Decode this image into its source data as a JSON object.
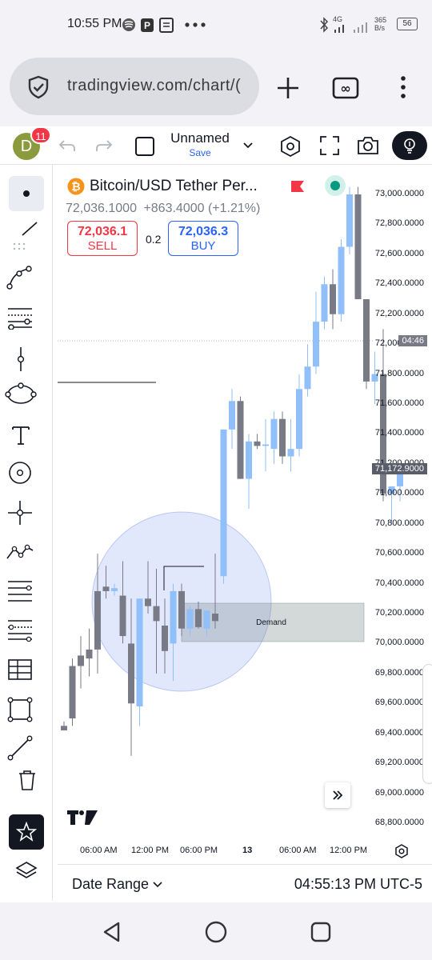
{
  "status_bar": {
    "time": "10:55 PM",
    "network_label": "4G",
    "speed_value": "365",
    "speed_unit": "B/s",
    "battery": "56"
  },
  "browser": {
    "url": "tradingview.com/chart/("
  },
  "toolbar": {
    "avatar_letter": "D",
    "notification_count": "11",
    "layout_name": "Unnamed",
    "save_label": "Save"
  },
  "symbol": {
    "title": "Bitcoin/USD Tether Per...",
    "last_price": "72,036.1000",
    "change": "+863.4000 (+1.21%)",
    "sell_price": "72,036.1",
    "sell_label": "SELL",
    "spread": "0.2",
    "buy_price": "72,036.3",
    "buy_label": "BUY"
  },
  "price_axis": {
    "ticks": [
      "73,000.0000",
      "72,800.0000",
      "72,600.0000",
      "72,400.0000",
      "72,200.0000",
      "72,000.0000",
      "71,800.0000",
      "71,600.0000",
      "71,400.0000",
      "71,200.0000",
      "71,000.0000",
      "70,800.0000",
      "70,600.0000",
      "70,400.0000",
      "70,200.0000",
      "70,000.0000",
      "69,800.0000",
      "69,600.0000",
      "69,400.0000",
      "69,200.0000",
      "69,000.0000",
      "68,800.0000"
    ],
    "countdown_tag": "04:46",
    "current_price_tag": "71,172.9000"
  },
  "time_axis": {
    "ticks": [
      "06:00 AM",
      "12:00 PM",
      "06:00 PM",
      "13",
      "06:00 AM",
      "12:00 PM"
    ]
  },
  "annotations": {
    "demand_label": "Demand"
  },
  "bottom_bar": {
    "date_range_label": "Date Range",
    "clock": "04:55:13 PM UTC-5"
  },
  "colors": {
    "up_candle": "#90bff9",
    "down_candle": "#787b86",
    "accent": "#2962ff",
    "sell": "#f23645",
    "notification": "#f23645"
  },
  "chart_data": {
    "type": "candlestick",
    "ylim": [
      68800,
      73000
    ],
    "candles": [
      {
        "o": 69450,
        "h": 69480,
        "l": 69420,
        "c": 69420
      },
      {
        "o": 69850,
        "h": 69900,
        "l": 69450,
        "c": 69500
      },
      {
        "o": 69920,
        "h": 70050,
        "l": 69700,
        "c": 69850
      },
      {
        "o": 69960,
        "h": 70100,
        "l": 69780,
        "c": 69900
      },
      {
        "o": 70350,
        "h": 70600,
        "l": 69800,
        "c": 69960
      },
      {
        "o": 70380,
        "h": 70520,
        "l": 70300,
        "c": 70350
      },
      {
        "o": 70350,
        "h": 70400,
        "l": 70320,
        "c": 70370
      },
      {
        "o": 70320,
        "h": 70550,
        "l": 70000,
        "c": 70050
      },
      {
        "o": 70000,
        "h": 70300,
        "l": 69250,
        "c": 69600
      },
      {
        "o": 69580,
        "h": 70100,
        "l": 69450,
        "c": 70300
      },
      {
        "o": 70300,
        "h": 70550,
        "l": 70200,
        "c": 70250
      },
      {
        "o": 70250,
        "h": 70500,
        "l": 69800,
        "c": 70150
      },
      {
        "o": 70120,
        "h": 70300,
        "l": 69800,
        "c": 69950
      },
      {
        "o": 70000,
        "h": 70400,
        "l": 69750,
        "c": 70350
      },
      {
        "o": 70350,
        "h": 70400,
        "l": 70050,
        "c": 70100
      },
      {
        "o": 70100,
        "h": 70250,
        "l": 70050,
        "c": 70230
      },
      {
        "o": 70230,
        "h": 70280,
        "l": 70100,
        "c": 70110
      },
      {
        "o": 70100,
        "h": 70200,
        "l": 70050,
        "c": 70220
      },
      {
        "o": 70200,
        "h": 70600,
        "l": 70100,
        "c": 70150
      },
      {
        "o": 70450,
        "h": 71400,
        "l": 70400,
        "c": 71430
      },
      {
        "o": 71430,
        "h": 71700,
        "l": 71300,
        "c": 71620
      },
      {
        "o": 71620,
        "h": 71650,
        "l": 71100,
        "c": 71100
      },
      {
        "o": 71100,
        "h": 71400,
        "l": 70900,
        "c": 71350
      },
      {
        "o": 71350,
        "h": 71400,
        "l": 71300,
        "c": 71320
      },
      {
        "o": 71320,
        "h": 71500,
        "l": 71150,
        "c": 71330
      },
      {
        "o": 71300,
        "h": 71550,
        "l": 71200,
        "c": 71500
      },
      {
        "o": 71500,
        "h": 71550,
        "l": 71200,
        "c": 71250
      },
      {
        "o": 71250,
        "h": 71500,
        "l": 71150,
        "c": 71300
      },
      {
        "o": 71300,
        "h": 71800,
        "l": 71250,
        "c": 71700
      },
      {
        "o": 71700,
        "h": 72000,
        "l": 71650,
        "c": 71850
      },
      {
        "o": 71850,
        "h": 72350,
        "l": 71800,
        "c": 72150
      },
      {
        "o": 72150,
        "h": 72450,
        "l": 72100,
        "c": 72400
      },
      {
        "o": 72400,
        "h": 72500,
        "l": 72100,
        "c": 72200
      },
      {
        "o": 72200,
        "h": 72700,
        "l": 72150,
        "c": 72650
      },
      {
        "o": 72650,
        "h": 73050,
        "l": 72600,
        "c": 73000
      },
      {
        "o": 73000,
        "h": 73050,
        "l": 72300,
        "c": 72300
      },
      {
        "o": 72300,
        "h": 72200,
        "l": 71700,
        "c": 71750
      },
      {
        "o": 71750,
        "h": 71950,
        "l": 71600,
        "c": 71800
      },
      {
        "o": 71800,
        "h": 72100,
        "l": 70950,
        "c": 71000
      },
      {
        "o": 71000,
        "h": 71050,
        "l": 70800,
        "c": 71050
      },
      {
        "o": 71050,
        "h": 71200,
        "l": 70950,
        "c": 71150
      }
    ]
  }
}
